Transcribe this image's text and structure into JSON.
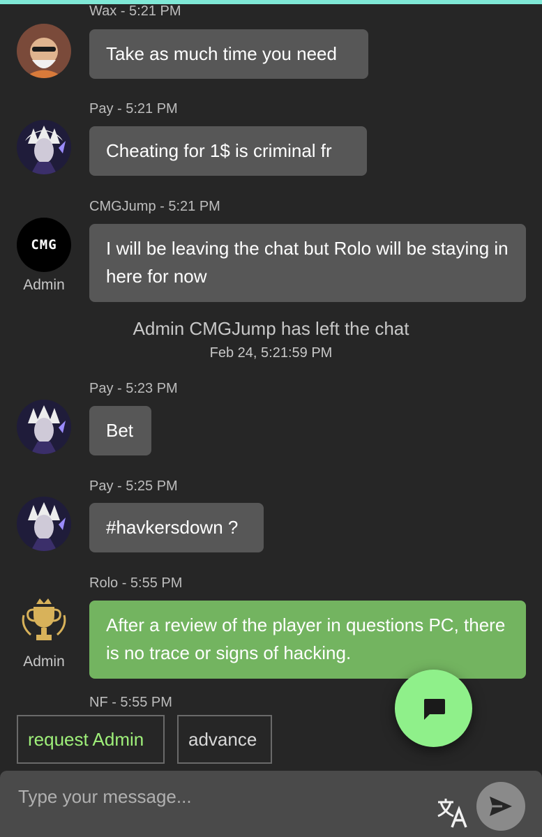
{
  "colors": {
    "background": "#262626",
    "bubble": "#575757",
    "admin_bubble": "#73b460",
    "fab": "#8ff08a",
    "accent_text": "#9ff07a",
    "top_bar": "#7fe8d6"
  },
  "messages": [
    {
      "meta": "Wax - 5:21 PM",
      "text": "Take as much time you need",
      "role": ""
    },
    {
      "meta": "Pay - 5:21 PM",
      "text": "Cheating for 1$ is criminal fr",
      "role": ""
    },
    {
      "meta": "CMGJump - 5:21 PM",
      "text": "I will be leaving the chat but Rolo will be staying in here for now",
      "role": "Admin",
      "avatar_text": "CMG"
    },
    {
      "meta": "Pay - 5:23 PM",
      "text": "Bet",
      "role": ""
    },
    {
      "meta": "Pay - 5:25 PM",
      "text": "#havkersdown ?",
      "role": ""
    },
    {
      "meta": "Rolo - 5:55 PM",
      "text": "After a review of the player in questions PC, there is no trace or signs of hacking.",
      "role": "Admin"
    },
    {
      "meta": "NF - 5:55 PM",
      "text": "",
      "role": ""
    }
  ],
  "system_event": {
    "text": "Admin CMGJump has left the chat",
    "date": "Feb 24, 5:21:59 PM"
  },
  "quick_actions": {
    "request_admin": "request Admin",
    "advance": "advance"
  },
  "composer": {
    "placeholder": "Type your message...",
    "translate_icon": "translate-icon",
    "send_icon": "send-icon"
  },
  "fab": {
    "icon": "chat-bubble-icon"
  }
}
